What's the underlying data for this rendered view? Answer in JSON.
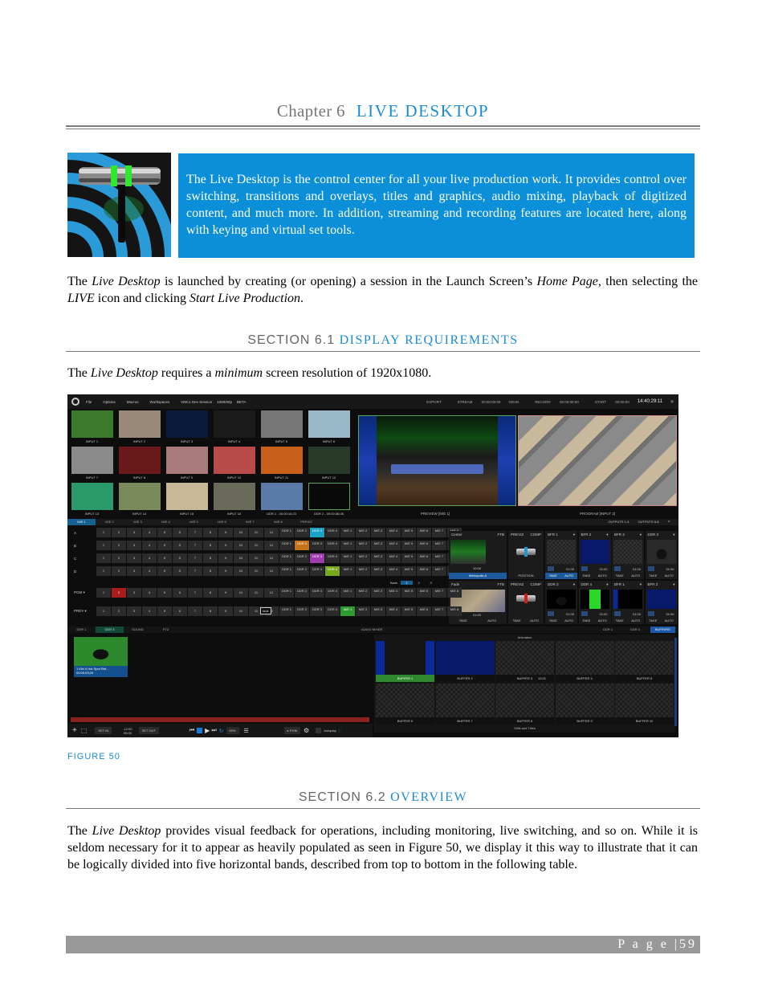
{
  "chapter": {
    "label": "Chapter 6",
    "title": "LIVE DESKTOP"
  },
  "intro_box": {
    "text": "The Live Desktop is the control center for all your live production work.  It provides control over switching, transitions and overlays, titles and graphics, audio mixing, playback of digitized content, and much more. In addition, streaming and recording features are located here, along with keying and virtual set tools."
  },
  "para1": {
    "t1": "The ",
    "i1": "Live Desktop",
    "t2": " is launched by creating (or opening) a session in the Launch Screen’s ",
    "i2": "Home Page",
    "t3": ", then selecting the ",
    "i3": "LIVE",
    "t4": " icon and clicking ",
    "i4": "Start Live Production",
    "t5": "."
  },
  "section1": {
    "label": "SECTION 6.1",
    "title": "DISPLAY REQUIREMENTS"
  },
  "para2": {
    "t1": "The ",
    "i1": "Live Desktop",
    "t2": " requires a ",
    "i2": "minimum",
    "t3": " screen resolution of 1920x1080."
  },
  "figure": {
    "caption": "FIGURE 50",
    "menubar": {
      "items": [
        "File",
        "Options",
        "Macros",
        "Workspaces",
        "VMC1 Dev Session",
        "1080/60p",
        "BETA"
      ],
      "export": "EXPORT",
      "stream": "STREAM",
      "stream_time": "00:00:00:00",
      "grab": "GRAB",
      "record": "RECORD",
      "record_time": "00:00:00:00",
      "start": "START",
      "start_time": "00:00:00",
      "clock": "14:40:29:11"
    },
    "multiview": [
      {
        "label": "INPUT 1",
        "color": "#3a7a2a"
      },
      {
        "label": "INPUT 2",
        "color": "#9a8a7a"
      },
      {
        "label": "INPUT 3",
        "color": "#0a1a3a"
      },
      {
        "label": "INPUT 4",
        "color": "#1a1a1a"
      },
      {
        "label": "INPUT 5",
        "color": "#777777"
      },
      {
        "label": "INPUT 6",
        "color": "#9ab8c8"
      },
      {
        "label": "INPUT 7",
        "color": "#8a8a8a"
      },
      {
        "label": "INPUT 8",
        "color": "#6a1a1a"
      },
      {
        "label": "INPUT 9",
        "color": "#a87a7a"
      },
      {
        "label": "INPUT 10",
        "color": "#b84a4a"
      },
      {
        "label": "INPUT 11",
        "color": "#c8601a"
      },
      {
        "label": "INPUT 12",
        "color": "#2a3a2a"
      },
      {
        "label": "INPUT 13",
        "color": "#2a9a6a"
      },
      {
        "label": "INPUT 14",
        "color": "#7a8a5a"
      },
      {
        "label": "INPUT 15",
        "color": "#c8b898"
      },
      {
        "label": "INPUT 16",
        "color": "#6a6a5a"
      },
      {
        "label": "DDR 1  -  00:00:10;23",
        "color": "#5a7aa8"
      },
      {
        "label": "DDR 2  -  00:00:36;06",
        "color": "#0a0a0a"
      }
    ],
    "preview_label": "PREVIEW [M/E 1]",
    "program_label": "PROGRAM [INPUT 2]",
    "me_tabs": [
      "M/E 1",
      "M/E 2",
      "M/E 3",
      "M/E 4",
      "M/E 5",
      "M/E 6",
      "M/E 7",
      "M/E 8",
      "PREVIZ"
    ],
    "outputs": [
      "OUTPUTS 1-4",
      "OUTPUTS 5-8"
    ],
    "me_rows": [
      {
        "label": "A",
        "highlight": "cyan",
        "hi_index": 2
      },
      {
        "label": "B",
        "highlight": "orange",
        "hi_index": 1
      },
      {
        "label": "C",
        "highlight": "purple",
        "hi_index": 2
      },
      {
        "label": "D",
        "highlight": "lime",
        "hi_index": 3
      }
    ],
    "numbers": [
      "1",
      "2",
      "3",
      "4",
      "5",
      "6",
      "7",
      "8",
      "9",
      "10",
      "11",
      "12"
    ],
    "ddr_buttons": [
      "DDR 1",
      "DDR 2",
      "DDR 3",
      "DDR 4"
    ],
    "me_buttons": [
      "M/E 1",
      "M/E 2",
      "M/E 3",
      "M/E 4",
      "M/E 5",
      "M/E 6",
      "M/E 7",
      "M/E 8"
    ],
    "upper_panels": {
      "transition": {
        "name": "Center",
        "ftb": "FTB",
        "rate": "10:00",
        "source": "Metropolis A"
      },
      "previz": {
        "label": "PREVIZ",
        "comp": "COMP",
        "position": "POSITION"
      },
      "overlays": [
        {
          "name": "BFR 1",
          "rate": "01:00"
        },
        {
          "name": "BFR 2",
          "rate": "01:00"
        },
        {
          "name": "BFR 3",
          "rate": "01:00"
        },
        {
          "name": "DDR 3",
          "rate": "01:00"
        }
      ],
      "take": "TAKE",
      "auto": "AUTO"
    },
    "main_rows": [
      {
        "label": "PGM ▾",
        "highlight_number": "2"
      },
      {
        "label": "PREV ▾",
        "tooltip": "fade",
        "highlight_me": "M/E 1"
      }
    ],
    "bank": {
      "label": "Bank",
      "values": [
        "1",
        "2",
        "3"
      ]
    },
    "lower_panels": {
      "transition": {
        "name": "Fade",
        "ftb": "FTB",
        "rate": "01:00"
      },
      "overlays": [
        {
          "name": "DDR 3",
          "rate": "01:00"
        },
        {
          "name": "DDR 4",
          "rate": "01:00"
        },
        {
          "name": "BFR 1",
          "rate": "01:00"
        },
        {
          "name": "BFR 2",
          "rate": "01:00"
        }
      ]
    },
    "lower_tabs": [
      "DDR 1",
      "DDR 3",
      "SOUND",
      "PTZ"
    ],
    "audio_mixer": "AUDIO MIXER",
    "right_tabs": [
      "DDR 2",
      "DDR 4",
      "BUFFERS"
    ],
    "clip": {
      "title": "1  Kiki 4 Hot Spot Ref...",
      "duration": "00:00:03;29"
    },
    "transport": {
      "set_in": "SET IN",
      "time_top": "-12:00",
      "time_bottom": "00:00",
      "set_out": "SET OUT",
      "speed": "50%",
      "pgm": "▸ PGM",
      "autoplay": "Autoplay"
    },
    "buffers": {
      "section_animation": "Animation",
      "section_stills": "Stills and Titles",
      "items": [
        "BUFFER 1",
        "BUFFER 2",
        "BUFFER 3",
        "BUFFER 4",
        "BUFFER 5",
        "BUFFER 6",
        "BUFFER 7",
        "BUFFER 8",
        "BUFFER 9",
        "BUFFER 10"
      ],
      "buffer3_rate": "12:01"
    }
  },
  "section2": {
    "label": "SECTION 6.2",
    "title": "OVERVIEW"
  },
  "para3": {
    "t1": "The ",
    "i1": "Live Desktop",
    "t2": " provides visual feedback for operations, including monitoring, live switching, and so on. While it is seldom necessary for it to appear as heavily populated as seen in Figure 50, we display it this way to illustrate that it can be logically divided into five horizontal bands, described from top to bottom in the following table."
  },
  "footer": {
    "page_label": "P a g e",
    "page_number": "59"
  }
}
